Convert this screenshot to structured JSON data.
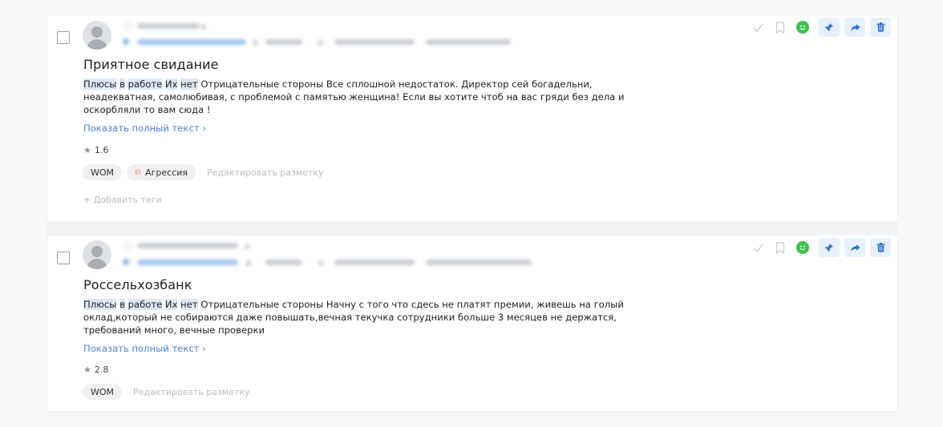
{
  "cards": [
    {
      "title": "Приятное свидание",
      "text_highlights": [
        "Плюсы",
        "в",
        "работе",
        "Их",
        "нет"
      ],
      "text_rest": "Отрицательные стороны Все сплошной недостаток. Директор сей богадельни, неадекватная, самолюбивая, с проблемой с памятью женщина! Если вы хотите чтоб на вас гряди без дела и оскорбляли то вам сюда !",
      "show_full": "Показать полный текст ›",
      "rating": "1.6",
      "tags": [
        "WOM",
        "Агрессия"
      ],
      "edit_markup": "Редактировать разметку",
      "add_tags": "+ Добавить теги"
    },
    {
      "title": "Россельхозбанк",
      "text_highlights": [
        "Плюсы",
        "в",
        "работе",
        "Их",
        "нет"
      ],
      "text_rest": "Отрицательные стороны Начну с того что сдесь не платят премии, живешь на голый оклад,который не собираются даже повышать,вечная текучка сотрудники больше 3 месяцев не держатся, требований много, вечные проверки",
      "show_full": "Показать полный текст ›",
      "rating": "2.8",
      "tags": [
        "WOM"
      ],
      "edit_markup": "Редактировать разметку"
    }
  ],
  "icons": {
    "check": "check-icon",
    "bookmark": "bookmark-icon",
    "sentiment": "positive-sentiment-icon",
    "pin": "pin-icon",
    "forward": "forward-icon",
    "delete": "trash-icon"
  },
  "colors": {
    "link": "#4a82d9",
    "highlight": "#dce8f8",
    "positive": "#3cc24a",
    "action_bg": "#e7f0fd",
    "action_icon": "#2f6fd6",
    "tag_bg": "#eff0f2",
    "fire": "#f07a2a"
  }
}
